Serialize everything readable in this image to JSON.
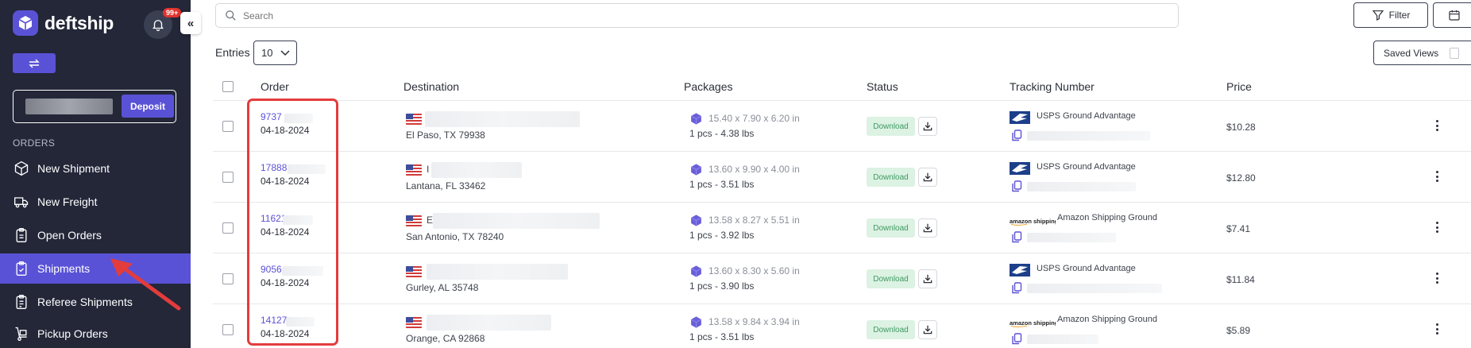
{
  "app": {
    "brand": "deftship"
  },
  "notifications": {
    "count": "99+"
  },
  "sidebar": {
    "deposit_label": "Deposit",
    "section_label": "ORDERS",
    "items": [
      {
        "label": "New Shipment",
        "icon": "box-3d-icon"
      },
      {
        "label": "New Freight",
        "icon": "truck-icon"
      },
      {
        "label": "Open Orders",
        "icon": "clipboard-icon"
      },
      {
        "label": "Shipments",
        "icon": "clipboard-check-icon",
        "active": true
      },
      {
        "label": "Referee Shipments",
        "icon": "clipboard-list-icon"
      },
      {
        "label": "Pickup Orders",
        "icon": "dolly-icon"
      }
    ]
  },
  "toolbar": {
    "search_placeholder": "Search",
    "filter_label": "Filter",
    "entries_label": "Entries",
    "entries_value": "10",
    "saved_views_label": "Saved Views"
  },
  "table": {
    "columns": [
      "Order",
      "Destination",
      "Packages",
      "Status",
      "Tracking Number",
      "Price"
    ],
    "rows": [
      {
        "order_id": "9737",
        "date": "04-18-2024",
        "dest_initial": "",
        "city": "El Paso, TX 79938",
        "dims": "15.40 x 7.90 x 6.20 in",
        "weight": "1 pcs - 4.38 lbs",
        "status": "Download",
        "carrier": "USPS Ground Advantage",
        "carrier_type": "usps",
        "price": "$10.28"
      },
      {
        "order_id": "17888",
        "date": "04-18-2024",
        "dest_initial": "I",
        "city": "Lantana, FL 33462",
        "dims": "13.60 x 9.90 x 4.00 in",
        "weight": "1 pcs - 3.51 lbs",
        "status": "Download",
        "carrier": "USPS Ground Advantage",
        "carrier_type": "usps",
        "price": "$12.80"
      },
      {
        "order_id": "11621",
        "date": "04-18-2024",
        "dest_initial": "E",
        "city": "San Antonio, TX 78240",
        "dims": "13.58 x 8.27 x 5.51 in",
        "weight": "1 pcs - 3.92 lbs",
        "status": "Download",
        "carrier": "Amazon Shipping Ground",
        "carrier_type": "amazon",
        "price": "$7.41"
      },
      {
        "order_id": "9056",
        "date": "04-18-2024",
        "dest_initial": "",
        "city": "Gurley, AL 35748",
        "dims": "13.60 x 8.30 x 5.60 in",
        "weight": "1 pcs - 3.90 lbs",
        "status": "Download",
        "carrier": "USPS Ground Advantage",
        "carrier_type": "usps",
        "price": "$11.84"
      },
      {
        "order_id": "14127",
        "date": "04-18-2024",
        "dest_initial": "",
        "city": "Orange, CA 92868",
        "dims": "13.58 x 9.84 x 3.94 in",
        "weight": "1 pcs - 3.51 lbs",
        "status": "Download",
        "carrier": "Amazon Shipping Ground",
        "carrier_type": "amazon",
        "price": "$5.89"
      }
    ]
  },
  "amazon_logo_text": "amazon shipping",
  "colors": {
    "sidebar_bg": "#232738",
    "accent": "#5a52d6",
    "highlight": "#e33c3c",
    "status_bg": "#dcf2e3",
    "status_text": "#3e9a62"
  }
}
